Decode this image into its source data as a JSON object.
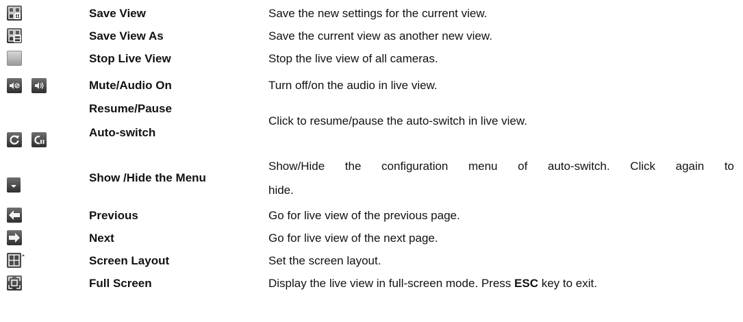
{
  "rows": [
    {
      "name": "Save View",
      "desc": "Save the new settings for the current view.",
      "icons": [
        "save-view-icon"
      ]
    },
    {
      "name": "Save View As",
      "desc": "Save the current view as another new view.",
      "icons": [
        "save-view-as-icon"
      ]
    },
    {
      "name": "Stop Live View",
      "desc": "Stop the live view of all cameras.",
      "icons": [
        "stop-live-view-icon"
      ]
    },
    {
      "name": "Mute/Audio On",
      "desc": "Turn off/on the audio in live view.",
      "icons": [
        "mute-icon",
        "audio-on-icon"
      ]
    },
    {
      "name_line1": "Resume/Pause",
      "name_line2": "Auto-switch",
      "desc": "Click to resume/pause the auto-switch in live view.",
      "icons": [
        "resume-icon",
        "pause-icon"
      ]
    },
    {
      "name": "Show /Hide the Menu",
      "desc_line1": "Show/Hide the configuration menu of auto-switch. Click again to",
      "desc_line2": "hide.",
      "icons": [
        "show-hide-menu-icon"
      ]
    },
    {
      "name": "Previous",
      "desc": "Go for live view of the previous page.",
      "icons": [
        "previous-arrow-icon"
      ]
    },
    {
      "name": "Next",
      "desc": "Go for live view of the next page.",
      "icons": [
        "next-arrow-icon"
      ]
    },
    {
      "name": "Screen Layout",
      "desc": "Set the screen layout.",
      "icons": [
        "screen-layout-icon"
      ]
    },
    {
      "name": "Full Screen",
      "desc_before": "Display the live view in full-screen mode. Press ",
      "desc_key": "ESC",
      "desc_after": " key to exit.",
      "icons": [
        "full-screen-icon"
      ]
    }
  ]
}
